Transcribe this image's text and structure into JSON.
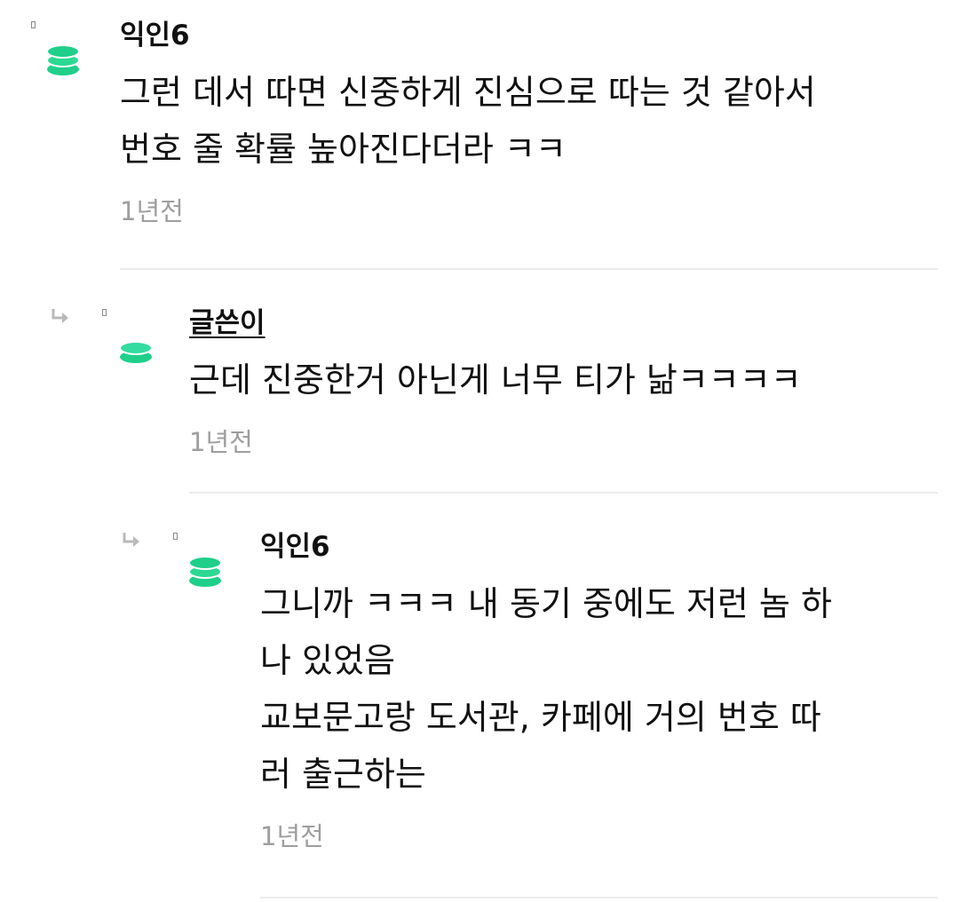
{
  "comments": [
    {
      "author": "익인6",
      "content_lines": [
        "그런 데서 따면 신중하게 진심으로 따는 것 같아서",
        "번호 줄 확률 높아진다더라 ㅋㅋ"
      ],
      "time": "1년전"
    },
    {
      "author": "글쓴이",
      "content_lines": [
        "근데 진중한거 아닌게 너무 티가 낢ㅋㅋㅋㅋ"
      ],
      "time": "1년전"
    },
    {
      "author": "익인6",
      "content_lines": [
        "그니까 ㅋㅋㅋ 내 동기 중에도 저런 놈 하",
        "나 있었음",
        "교보문고랑 도서관, 카페에 거의 번호 따",
        "러 출근하는"
      ],
      "time": "1년전"
    }
  ],
  "icons": {
    "avatar": "green-stacked-layers-icon",
    "reply": "reply-arrow-icon"
  },
  "colors": {
    "avatar_green": "#1fcf8a",
    "time_gray": "#9e9e9e",
    "divider": "#ececec"
  }
}
